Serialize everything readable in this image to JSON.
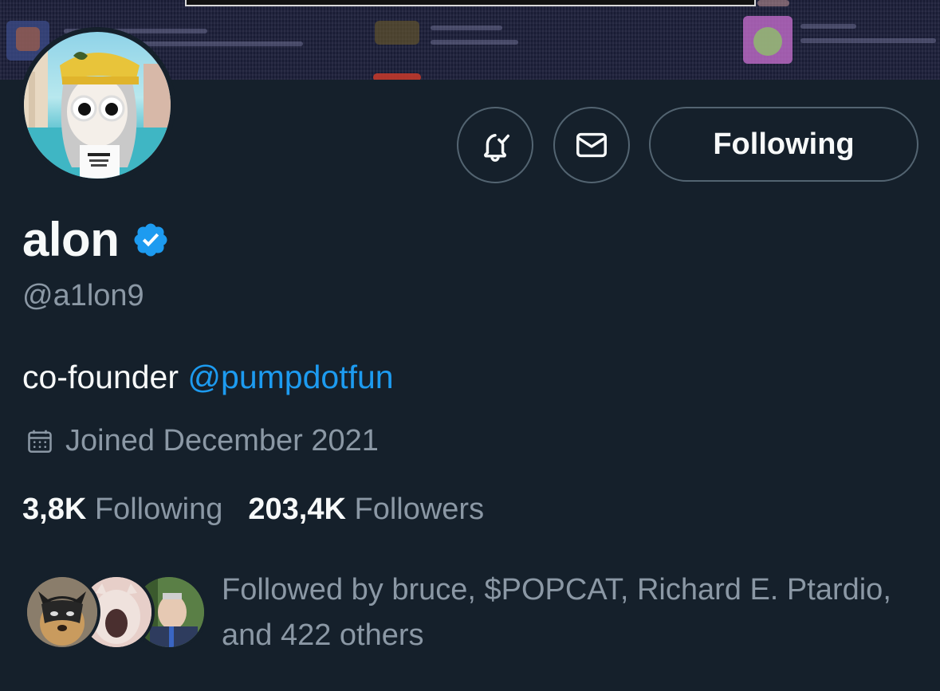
{
  "profile": {
    "display_name": "alon",
    "handle": "@a1lon9",
    "bio_text": "co-founder ",
    "bio_mention": "@pumpdotfun",
    "joined": "Joined December 2021",
    "verified": true
  },
  "actions": {
    "follow_label": "Following",
    "notify_icon": "bell-check-icon",
    "message_icon": "mail-icon"
  },
  "stats": {
    "following_count": "3,8K",
    "following_label": "Following",
    "followers_count": "203,4K",
    "followers_label": "Followers"
  },
  "followed_by": {
    "text": "Followed by bruce, $POPCAT, Richard E. Ptardio, and 422 others"
  },
  "colors": {
    "background": "#15202b",
    "accent": "#1d9bf0",
    "secondary_text": "#8b98a5",
    "border": "#536471"
  }
}
